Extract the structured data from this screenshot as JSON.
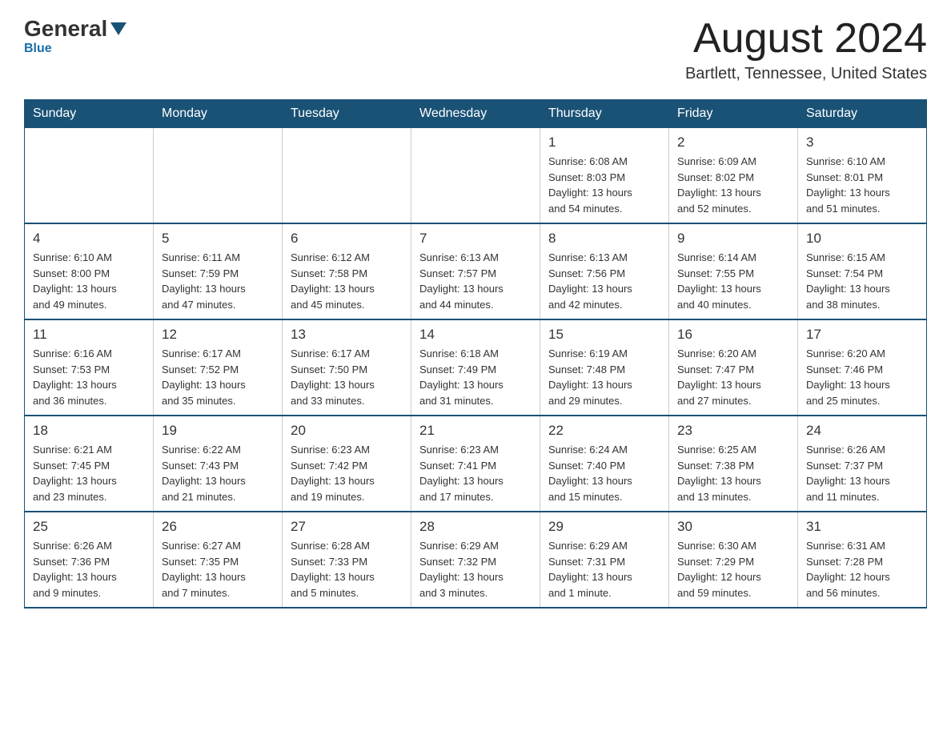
{
  "logo": {
    "general": "General",
    "blue": "Blue"
  },
  "title": {
    "month": "August 2024",
    "location": "Bartlett, Tennessee, United States"
  },
  "weekdays": [
    "Sunday",
    "Monday",
    "Tuesday",
    "Wednesday",
    "Thursday",
    "Friday",
    "Saturday"
  ],
  "weeks": [
    [
      {
        "day": "",
        "info": ""
      },
      {
        "day": "",
        "info": ""
      },
      {
        "day": "",
        "info": ""
      },
      {
        "day": "",
        "info": ""
      },
      {
        "day": "1",
        "info": "Sunrise: 6:08 AM\nSunset: 8:03 PM\nDaylight: 13 hours\nand 54 minutes."
      },
      {
        "day": "2",
        "info": "Sunrise: 6:09 AM\nSunset: 8:02 PM\nDaylight: 13 hours\nand 52 minutes."
      },
      {
        "day": "3",
        "info": "Sunrise: 6:10 AM\nSunset: 8:01 PM\nDaylight: 13 hours\nand 51 minutes."
      }
    ],
    [
      {
        "day": "4",
        "info": "Sunrise: 6:10 AM\nSunset: 8:00 PM\nDaylight: 13 hours\nand 49 minutes."
      },
      {
        "day": "5",
        "info": "Sunrise: 6:11 AM\nSunset: 7:59 PM\nDaylight: 13 hours\nand 47 minutes."
      },
      {
        "day": "6",
        "info": "Sunrise: 6:12 AM\nSunset: 7:58 PM\nDaylight: 13 hours\nand 45 minutes."
      },
      {
        "day": "7",
        "info": "Sunrise: 6:13 AM\nSunset: 7:57 PM\nDaylight: 13 hours\nand 44 minutes."
      },
      {
        "day": "8",
        "info": "Sunrise: 6:13 AM\nSunset: 7:56 PM\nDaylight: 13 hours\nand 42 minutes."
      },
      {
        "day": "9",
        "info": "Sunrise: 6:14 AM\nSunset: 7:55 PM\nDaylight: 13 hours\nand 40 minutes."
      },
      {
        "day": "10",
        "info": "Sunrise: 6:15 AM\nSunset: 7:54 PM\nDaylight: 13 hours\nand 38 minutes."
      }
    ],
    [
      {
        "day": "11",
        "info": "Sunrise: 6:16 AM\nSunset: 7:53 PM\nDaylight: 13 hours\nand 36 minutes."
      },
      {
        "day": "12",
        "info": "Sunrise: 6:17 AM\nSunset: 7:52 PM\nDaylight: 13 hours\nand 35 minutes."
      },
      {
        "day": "13",
        "info": "Sunrise: 6:17 AM\nSunset: 7:50 PM\nDaylight: 13 hours\nand 33 minutes."
      },
      {
        "day": "14",
        "info": "Sunrise: 6:18 AM\nSunset: 7:49 PM\nDaylight: 13 hours\nand 31 minutes."
      },
      {
        "day": "15",
        "info": "Sunrise: 6:19 AM\nSunset: 7:48 PM\nDaylight: 13 hours\nand 29 minutes."
      },
      {
        "day": "16",
        "info": "Sunrise: 6:20 AM\nSunset: 7:47 PM\nDaylight: 13 hours\nand 27 minutes."
      },
      {
        "day": "17",
        "info": "Sunrise: 6:20 AM\nSunset: 7:46 PM\nDaylight: 13 hours\nand 25 minutes."
      }
    ],
    [
      {
        "day": "18",
        "info": "Sunrise: 6:21 AM\nSunset: 7:45 PM\nDaylight: 13 hours\nand 23 minutes."
      },
      {
        "day": "19",
        "info": "Sunrise: 6:22 AM\nSunset: 7:43 PM\nDaylight: 13 hours\nand 21 minutes."
      },
      {
        "day": "20",
        "info": "Sunrise: 6:23 AM\nSunset: 7:42 PM\nDaylight: 13 hours\nand 19 minutes."
      },
      {
        "day": "21",
        "info": "Sunrise: 6:23 AM\nSunset: 7:41 PM\nDaylight: 13 hours\nand 17 minutes."
      },
      {
        "day": "22",
        "info": "Sunrise: 6:24 AM\nSunset: 7:40 PM\nDaylight: 13 hours\nand 15 minutes."
      },
      {
        "day": "23",
        "info": "Sunrise: 6:25 AM\nSunset: 7:38 PM\nDaylight: 13 hours\nand 13 minutes."
      },
      {
        "day": "24",
        "info": "Sunrise: 6:26 AM\nSunset: 7:37 PM\nDaylight: 13 hours\nand 11 minutes."
      }
    ],
    [
      {
        "day": "25",
        "info": "Sunrise: 6:26 AM\nSunset: 7:36 PM\nDaylight: 13 hours\nand 9 minutes."
      },
      {
        "day": "26",
        "info": "Sunrise: 6:27 AM\nSunset: 7:35 PM\nDaylight: 13 hours\nand 7 minutes."
      },
      {
        "day": "27",
        "info": "Sunrise: 6:28 AM\nSunset: 7:33 PM\nDaylight: 13 hours\nand 5 minutes."
      },
      {
        "day": "28",
        "info": "Sunrise: 6:29 AM\nSunset: 7:32 PM\nDaylight: 13 hours\nand 3 minutes."
      },
      {
        "day": "29",
        "info": "Sunrise: 6:29 AM\nSunset: 7:31 PM\nDaylight: 13 hours\nand 1 minute."
      },
      {
        "day": "30",
        "info": "Sunrise: 6:30 AM\nSunset: 7:29 PM\nDaylight: 12 hours\nand 59 minutes."
      },
      {
        "day": "31",
        "info": "Sunrise: 6:31 AM\nSunset: 7:28 PM\nDaylight: 12 hours\nand 56 minutes."
      }
    ]
  ]
}
